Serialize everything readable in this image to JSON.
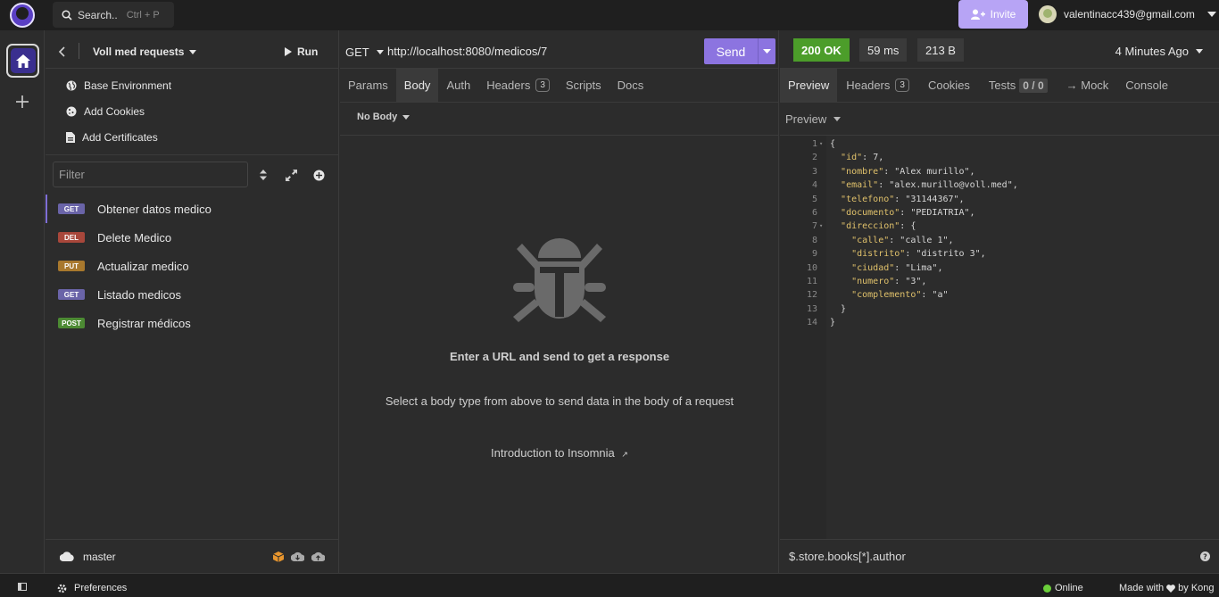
{
  "search": {
    "label": "Search..",
    "shortcut": "Ctrl + P"
  },
  "invite": {
    "label": "Invite"
  },
  "account": {
    "email": "valentinacc439@gmail.com"
  },
  "collection": {
    "title": "Voll med requests",
    "run_label": "Run"
  },
  "sidebar": {
    "links": [
      {
        "label": "Base Environment",
        "icon": "globe-icon"
      },
      {
        "label": "Add Cookies",
        "icon": "cookie-icon"
      },
      {
        "label": "Add Certificates",
        "icon": "certificate-icon"
      }
    ],
    "filter_placeholder": "Filter",
    "requests": [
      {
        "method": "GET",
        "name": "Obtener datos medico",
        "color": "#6a64a8",
        "active": true
      },
      {
        "method": "DEL",
        "name": "Delete Medico",
        "color": "#a8473b",
        "active": false
      },
      {
        "method": "PUT",
        "name": "Actualizar medico",
        "color": "#a8782d",
        "active": false
      },
      {
        "method": "GET",
        "name": "Listado medicos",
        "color": "#6a64a8",
        "active": false
      },
      {
        "method": "POST",
        "name": "Registrar médicos",
        "color": "#4c8a33",
        "active": false
      }
    ],
    "branch": "master"
  },
  "request": {
    "method": "GET",
    "url": "http://localhost:8080/medicos/7",
    "send_label": "Send",
    "tabs": [
      {
        "label": "Params"
      },
      {
        "label": "Body",
        "active": true
      },
      {
        "label": "Auth"
      },
      {
        "label": "Headers",
        "count": "3"
      },
      {
        "label": "Scripts"
      },
      {
        "label": "Docs"
      }
    ],
    "body_type": "No Body",
    "empty_title": "Enter a URL and send to get a response",
    "empty_subtitle": "Select a body type from above to send data in the body of a request",
    "intro_link": "Introduction to Insomnia"
  },
  "response": {
    "status": "200 OK",
    "time": "59 ms",
    "size": "213 B",
    "ago": "4 Minutes Ago",
    "tabs": [
      {
        "label": "Preview",
        "active": true
      },
      {
        "label": "Headers",
        "count": "3"
      },
      {
        "label": "Cookies"
      },
      {
        "label": "Tests",
        "count": "0 / 0"
      },
      {
        "label": "→ Mock"
      },
      {
        "label": "Console"
      }
    ],
    "preview_label": "Preview",
    "json_lines": [
      "{",
      "  \"id\": 7,",
      "  \"nombre\": \"Alex murillo\",",
      "  \"email\": \"alex.murillo@voll.med\",",
      "  \"telefono\": \"31144367\",",
      "  \"documento\": \"PEDIATRIA\",",
      "  \"direccion\": {",
      "    \"calle\": \"calle 1\",",
      "    \"distrito\": \"distrito 3\",",
      "    \"ciudad\": \"Lima\",",
      "    \"numero\": \"3\",",
      "    \"complemento\": \"a\"",
      "  }",
      "}"
    ],
    "jsonpath_placeholder": "$.store.books[*].author"
  },
  "footer": {
    "preferences": "Preferences",
    "online": "Online",
    "made_with": "Made with",
    "by_kong": "by Kong"
  }
}
